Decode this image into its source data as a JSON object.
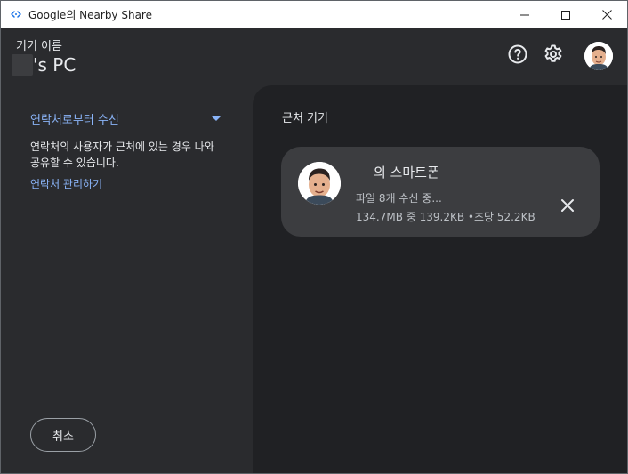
{
  "window": {
    "title": "Google의 Nearby Share",
    "controls": {
      "minimize_icon": "minimize-icon",
      "maximize_icon": "maximize-icon",
      "close_icon": "close-icon"
    }
  },
  "header": {
    "device_label": "기기 이름",
    "device_name_suffix": "'s PC",
    "help_icon": "help-circle-icon",
    "settings_icon": "gear-icon",
    "avatar_icon": "avatar"
  },
  "sidebar": {
    "receive_option": "연락처로부터 수신",
    "description": "연락처의 사용자가 근처에 있는 경우 나와 공유할 수 있습니다.",
    "manage_link": "연락처 관리하기",
    "cancel_label": "취소"
  },
  "main": {
    "section_title": "근처 기기",
    "transfer": {
      "device_name_suffix": "의 스마트폰",
      "status": "파일 8개 수신 중...",
      "progress_text": "134.7MB 중 139.2KB •초당 52.2KB"
    }
  },
  "colors": {
    "accent": "#8ab4f8",
    "panel_left": "#2a2b2e",
    "panel_right": "#202124",
    "card": "#3c3d40",
    "text": "#e8eaed"
  }
}
